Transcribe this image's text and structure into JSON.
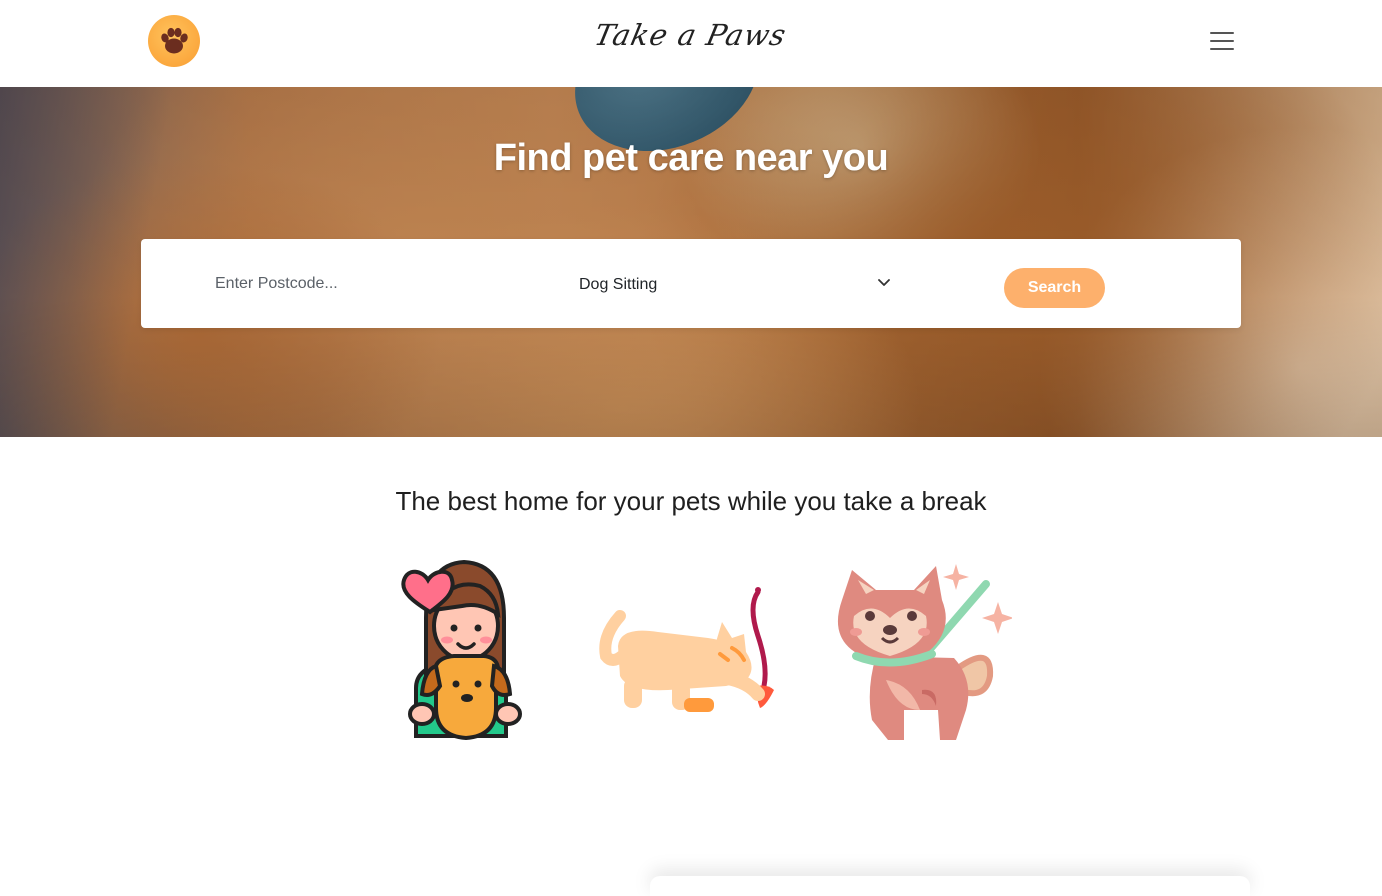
{
  "navbar": {
    "brand": "Take a Paws",
    "logo_icon": "paw-icon",
    "menu_icon": "hamburger-menu-icon"
  },
  "hero": {
    "title": "Find pet care near you"
  },
  "search": {
    "postcode_placeholder": "Enter Postcode...",
    "postcode_value": "",
    "service_selected": "Dog Sitting",
    "service_icon": "chevron-down-icon",
    "button_label": "Search"
  },
  "features": {
    "title": "The best home for your pets while you take a break",
    "illustrations": [
      "girl-hugging-dog-illustration",
      "cat-playing-illustration",
      "shiba-on-leash-illustration"
    ]
  },
  "colors": {
    "accent": "#fdb06c",
    "logo": "#fba83e",
    "paw": "#6b2d1f"
  }
}
